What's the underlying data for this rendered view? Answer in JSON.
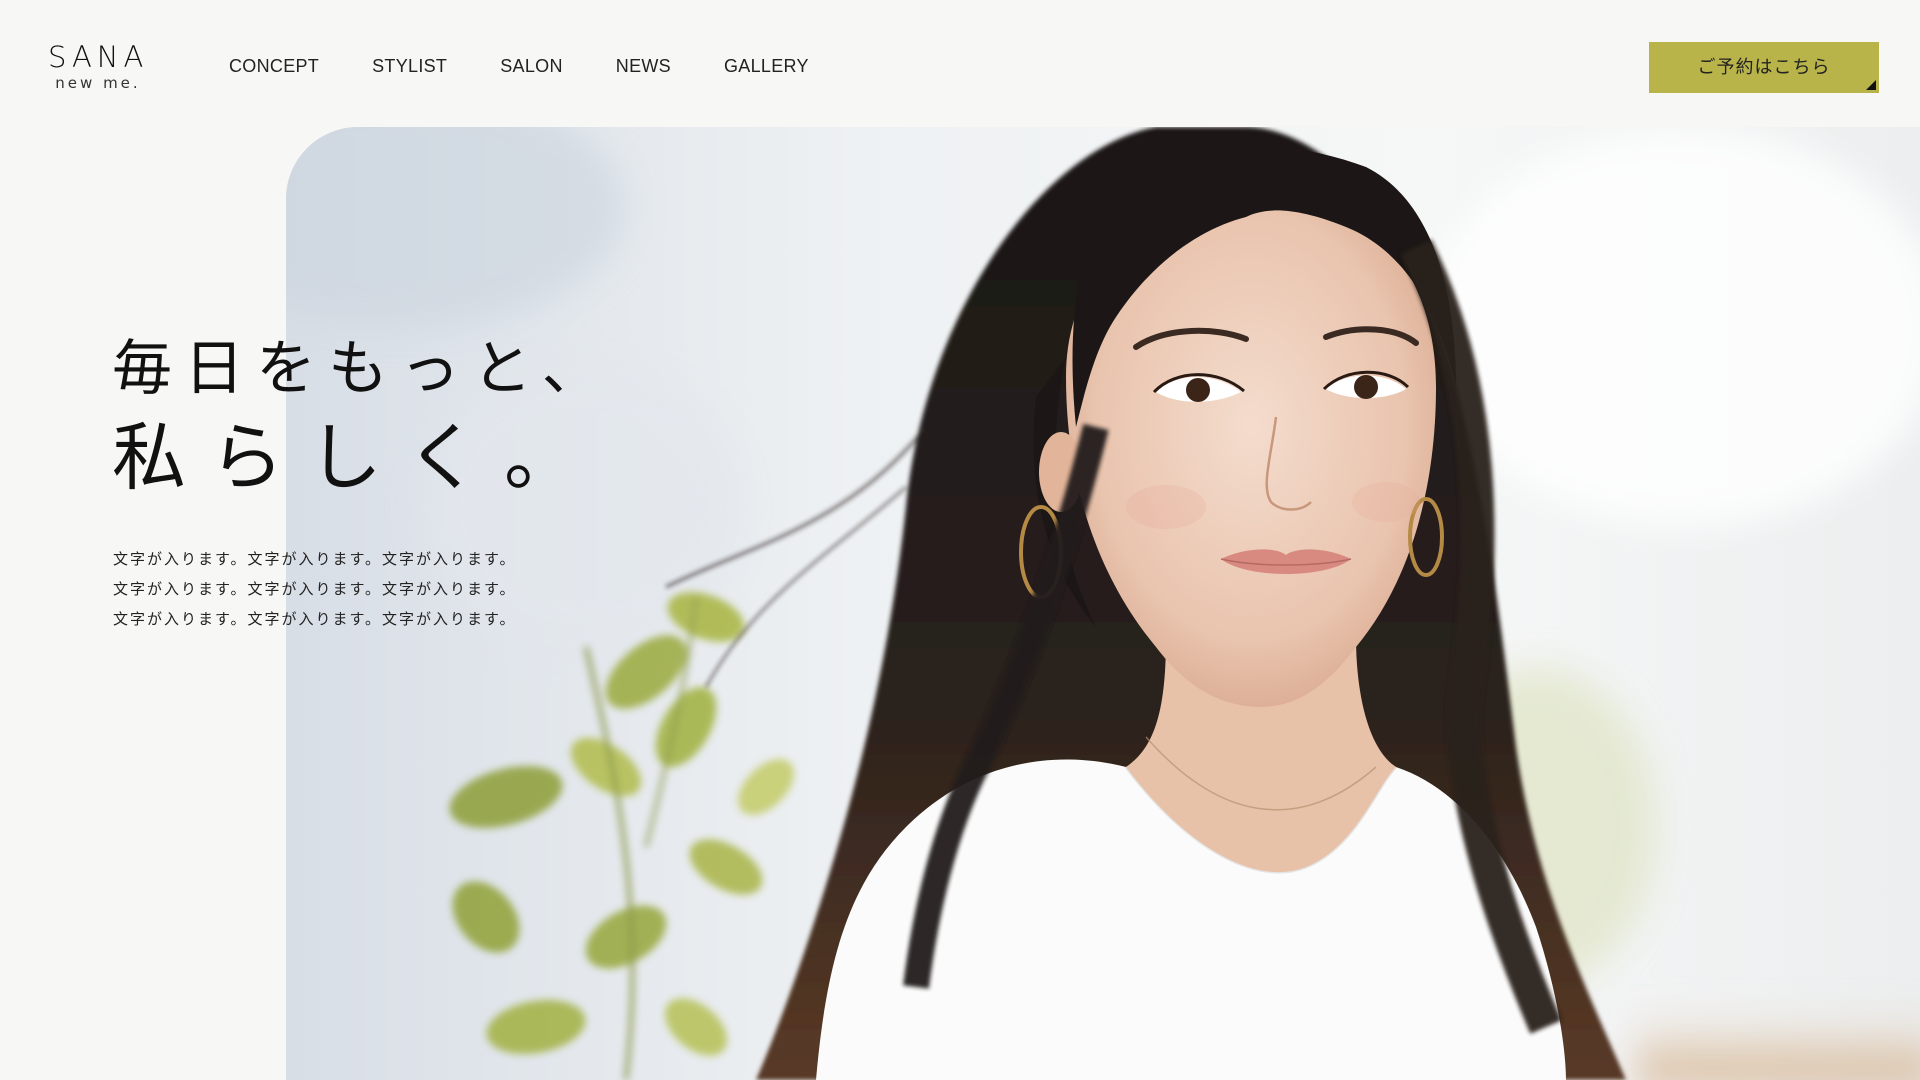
{
  "header": {
    "logo_main": "SANA",
    "logo_sub": "new me.",
    "nav": [
      {
        "label": "CONCEPT"
      },
      {
        "label": "STYLIST"
      },
      {
        "label": "SALON"
      },
      {
        "label": "NEWS"
      },
      {
        "label": "GALLERY"
      }
    ],
    "reserve_label": "ご予約はこちら"
  },
  "hero": {
    "catch_line1": "毎日をもっと、",
    "catch_line2": "私らしく。",
    "description": [
      "文字が入ります。文字が入ります。文字が入ります。",
      "文字が入ります。文字が入ります。文字が入ります。",
      "文字が入ります。文字が入ります。文字が入ります。"
    ]
  },
  "colors": {
    "background": "#f7f7f5",
    "accent": "#b8b44a",
    "text": "#111111"
  }
}
